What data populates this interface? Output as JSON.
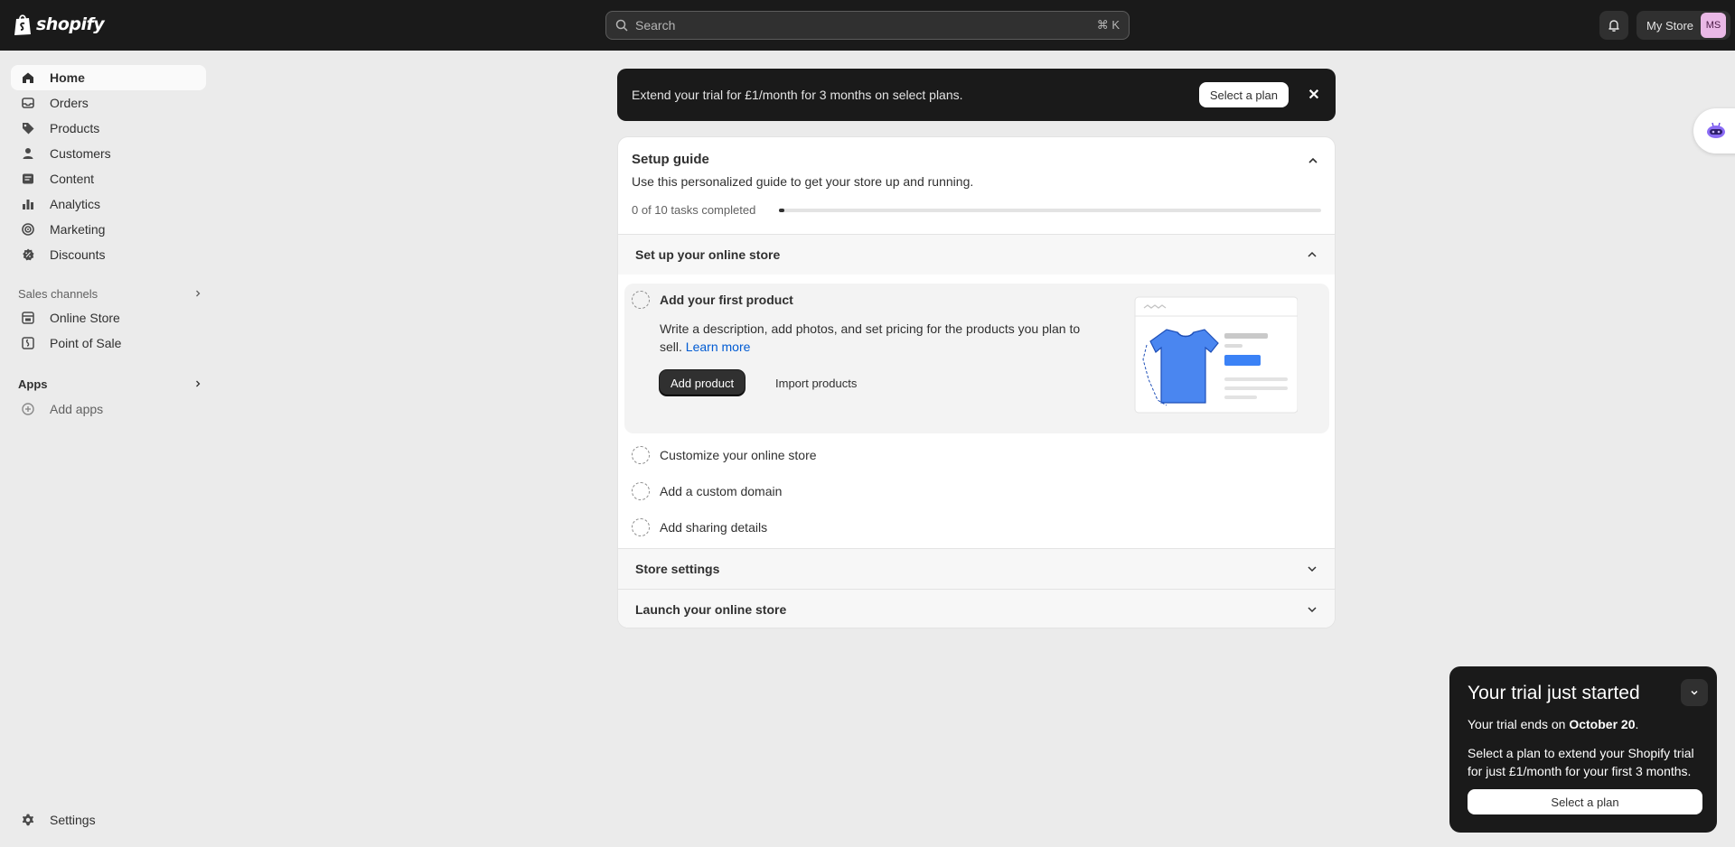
{
  "topbar": {
    "logo_text": "shopify",
    "search_placeholder": "Search",
    "search_shortcut": "⌘ K",
    "store_name": "My Store",
    "avatar_initials": "MS"
  },
  "sidebar": {
    "items": [
      {
        "label": "Home",
        "icon": "home-icon"
      },
      {
        "label": "Orders",
        "icon": "inbox-icon"
      },
      {
        "label": "Products",
        "icon": "tag-icon"
      },
      {
        "label": "Customers",
        "icon": "person-icon"
      },
      {
        "label": "Content",
        "icon": "document-icon"
      },
      {
        "label": "Analytics",
        "icon": "bar-chart-icon"
      },
      {
        "label": "Marketing",
        "icon": "target-icon"
      },
      {
        "label": "Discounts",
        "icon": "discount-icon"
      }
    ],
    "sales_channels_label": "Sales channels",
    "channels": [
      {
        "label": "Online Store",
        "icon": "store-icon"
      },
      {
        "label": "Point of Sale",
        "icon": "pos-icon"
      }
    ],
    "apps_label": "Apps",
    "add_apps_label": "Add apps",
    "settings_label": "Settings"
  },
  "banner": {
    "text": "Extend your trial for £1/month for 3 months on select plans.",
    "button": "Select a plan",
    "close": "✕"
  },
  "setup_guide": {
    "title": "Setup guide",
    "subtitle": "Use this personalized guide to get your store up and running.",
    "progress_text": "0 of 10 tasks completed",
    "progress_fraction": 0.0,
    "section_1": "Set up your online store",
    "active_task": {
      "title": "Add your first product",
      "description": "Write a description, add photos, and set pricing for the products you plan to sell.",
      "learn_more": "Learn more",
      "primary_button": "Add product",
      "secondary_button": "Import products"
    },
    "tasks": [
      "Customize your online store",
      "Add a custom domain",
      "Add sharing details"
    ],
    "section_2": "Store settings",
    "section_3": "Launch your online store"
  },
  "trial_popup": {
    "title": "Your trial just started",
    "ends_prefix": "Your trial ends on ",
    "ends_date": "October 20",
    "ends_suffix": ".",
    "body": "Select a plan to extend your Shopify trial for just £1/month for your first 3 months.",
    "button": "Select a plan"
  },
  "colors": {
    "topbar": "#1a1a1a",
    "background": "#ebebeb",
    "link": "#005bd3",
    "accent_illustration": "#3b82f6"
  }
}
